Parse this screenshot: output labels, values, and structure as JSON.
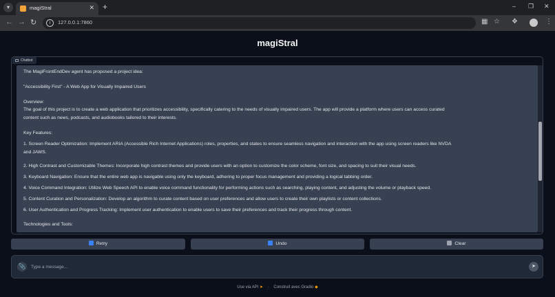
{
  "browser": {
    "tab_title": "magiStral",
    "url": "127.0.0.1:7860"
  },
  "app": {
    "title": "magiStral",
    "chatbot_label": "Chatbot"
  },
  "chat": {
    "lines": [
      "The MagiFrontEndDev agent has proposed a project idea:",
      "\"Accessibility First\" - A Web App for Visually Impaired Users",
      "Overview:",
      "The goal of this project is to create a web application that prioritizes accessibility, specifically catering to the needs of visually impaired users. The app will provide a platform where users can access curated",
      "content such as news, podcasts, and audiobooks tailored to their interests.",
      "Key Features:",
      "1. Screen Reader Optimization: Implement ARIA (Accessible Rich Internet Applications) roles, properties, and states to ensure seamless navigation and interaction with the app using screen readers like NVDA",
      "and JAWS.",
      "2. High Contrast and Customizable Themes: Incorporate high contrast themes and provide users with an option to customize the color scheme, font size, and spacing to suit their visual needs.",
      "3. Keyboard Navigation: Ensure that the entire web app is navigable using only the keyboard, adhering to proper focus management and providing a logical tabbing order.",
      "4. Voice Command Integration: Utilize Web Speech API to enable voice command functionality for performing actions such as searching, playing content, and adjusting the volume or playback speed.",
      "5. Content Curation and Personalization: Develop an algorithm to curate content based on user preferences and allow users to create their own playlists or content collections.",
      "6. User Authentication and Progress Tracking: Implement user authentication to enable users to save their preferences and track their progress through content.",
      "Technologies and Tools:"
    ]
  },
  "buttons": {
    "retry": "Retry",
    "undo": "Undo",
    "clear": "Clear"
  },
  "input": {
    "placeholder": "Type a message..."
  },
  "footer": {
    "api": "Use via API",
    "built": "Construit avec Gradio"
  }
}
